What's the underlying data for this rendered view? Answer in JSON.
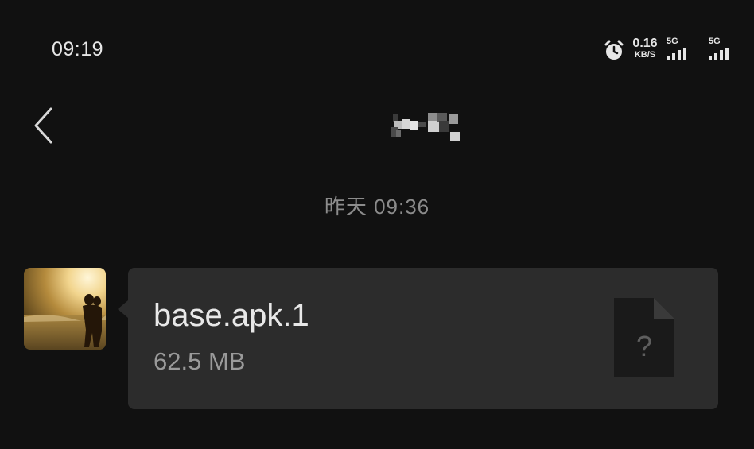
{
  "status_bar": {
    "time": "09:19",
    "alarm_icon": "alarm-clock-icon",
    "net_speed_value": "0.16",
    "net_speed_unit": "KB/S",
    "signals": [
      {
        "tag": "5G",
        "icon": "signal-bars-icon"
      },
      {
        "tag": "5G",
        "icon": "signal-bars-icon"
      }
    ]
  },
  "header": {
    "back_icon": "chevron-left-icon",
    "contact_name_icon": "pixelated-name"
  },
  "conversation": {
    "timestamp": "昨天 09:36",
    "messages": [
      {
        "sender_avatar": "couple-beach-sunset-avatar",
        "type": "file",
        "file_name": "base.apk.1",
        "file_size": "62.5 MB",
        "file_icon": "unknown-file-icon",
        "file_icon_symbol": "?"
      }
    ]
  },
  "colors": {
    "background": "#111111",
    "bubble": "#2c2c2c",
    "file_icon": "#1a1a1a",
    "primary_text": "#e8e8e8",
    "secondary_text": "#9a9a9a"
  }
}
